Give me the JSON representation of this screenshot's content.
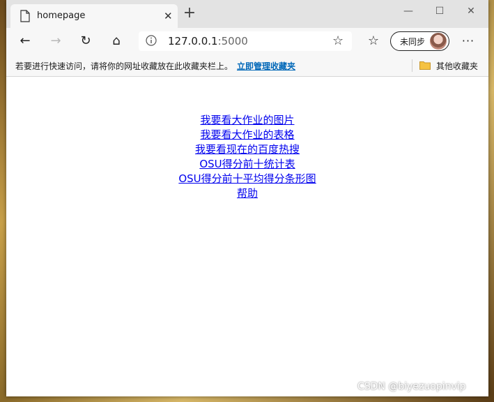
{
  "tab": {
    "title": "homepage",
    "close_glyph": "✕",
    "icon": "page-icon"
  },
  "new_tab_glyph": "+",
  "window_controls": {
    "minimize": "—",
    "maximize": "☐",
    "close": "✕"
  },
  "toolbar": {
    "back_glyph": "←",
    "forward_glyph": "→",
    "reload_glyph": "↻",
    "home_glyph": "⌂",
    "favorites_glyph": "☆",
    "more_glyph": "···",
    "address": {
      "host": "127.0.0.1",
      "port": ":5000",
      "star_glyph": "☆"
    },
    "sync_label": "未同步"
  },
  "favorites_bar": {
    "hint": "若要进行快速访问，请将你的网址收藏放在此收藏夹栏上。",
    "manage_link": "立即管理收藏夹",
    "other_favorites": "其他收藏夹"
  },
  "page_links": [
    "我要看大作业的图片",
    "我要看大作业的表格",
    "我要看现在的百度热搜",
    "OSU得分前十统计表",
    "OSU得分前十平均得分条形图",
    "帮助"
  ],
  "watermark": "CSDN @biyezuopinvip"
}
